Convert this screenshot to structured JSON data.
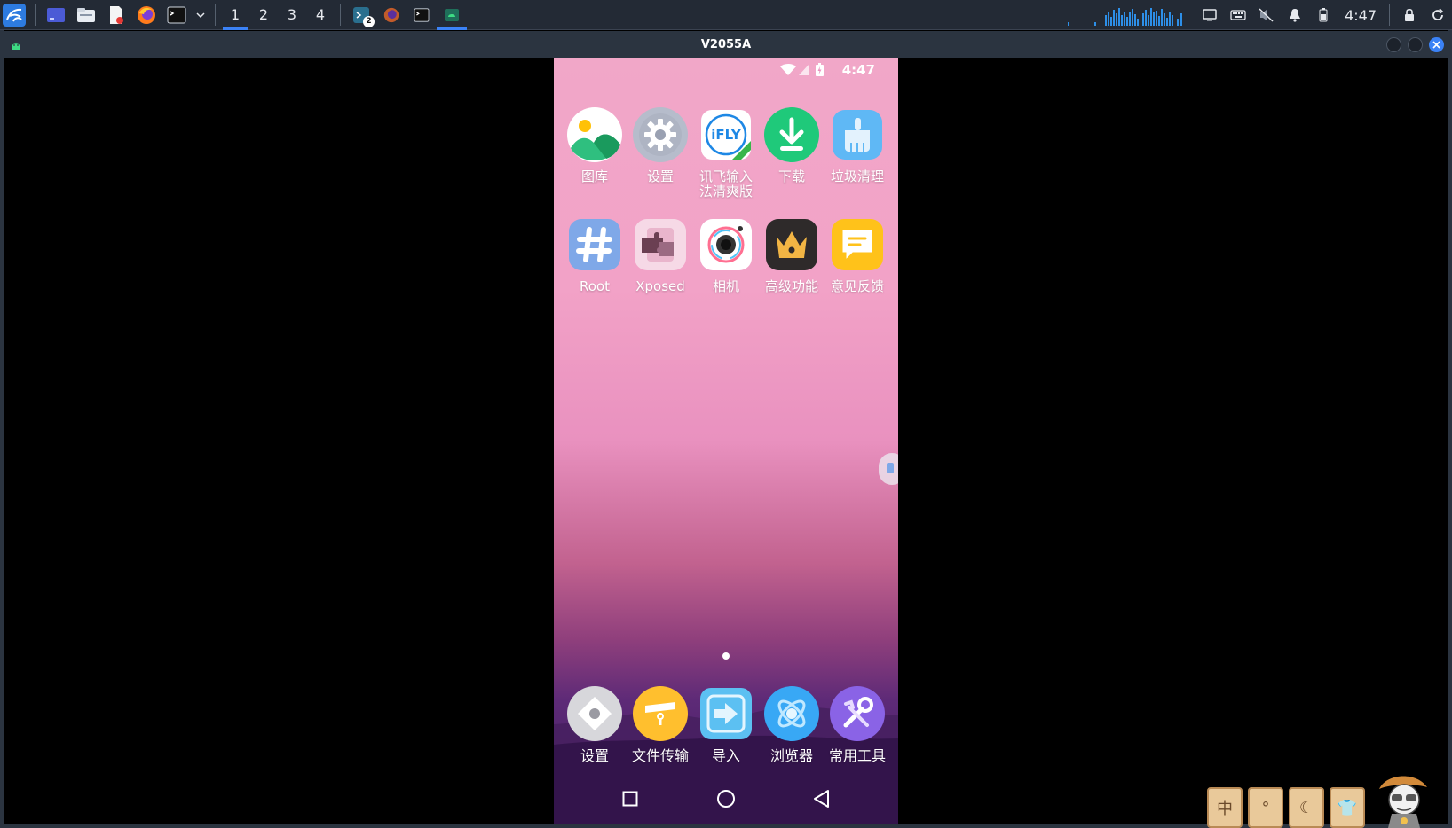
{
  "taskbar": {
    "workspaces": [
      {
        "label": "1",
        "active": true
      },
      {
        "label": "2",
        "active": false
      },
      {
        "label": "3",
        "active": false
      },
      {
        "label": "4",
        "active": false
      }
    ],
    "task_badge": "2",
    "clock": "4:47"
  },
  "window": {
    "title": "V2055A"
  },
  "phone": {
    "status_time": "4:47",
    "apps_row1": [
      {
        "label": "图库",
        "icon": "gallery-icon"
      },
      {
        "label": "设置",
        "icon": "gear-icon"
      },
      {
        "label": "讯飞输入\n法清爽版",
        "icon": "ifly-icon",
        "icon_text": "iFLY"
      },
      {
        "label": "下载",
        "icon": "download-icon"
      },
      {
        "label": "垃圾清理",
        "icon": "broom-icon"
      }
    ],
    "apps_row2": [
      {
        "label": "Root",
        "icon": "hash-icon"
      },
      {
        "label": "Xposed",
        "icon": "puzzle-icon"
      },
      {
        "label": "相机",
        "icon": "camera-icon"
      },
      {
        "label": "高级功能",
        "icon": "crown-icon"
      },
      {
        "label": "意见反馈",
        "icon": "feedback-icon"
      }
    ],
    "dock": [
      {
        "label": "设置",
        "icon": "settings-diamond-icon"
      },
      {
        "label": "文件传输",
        "icon": "file-transfer-icon"
      },
      {
        "label": "导入",
        "icon": "import-icon"
      },
      {
        "label": "浏览器",
        "icon": "browser-icon"
      },
      {
        "label": "常用工具",
        "icon": "tools-icon"
      }
    ]
  },
  "mascot": {
    "tiles": [
      "中",
      "°",
      "☾",
      "👕"
    ]
  },
  "colors": {
    "accent": "#3b82f6",
    "taskbar_bg": "#232a35",
    "titlebar_bg": "#2b3440"
  }
}
